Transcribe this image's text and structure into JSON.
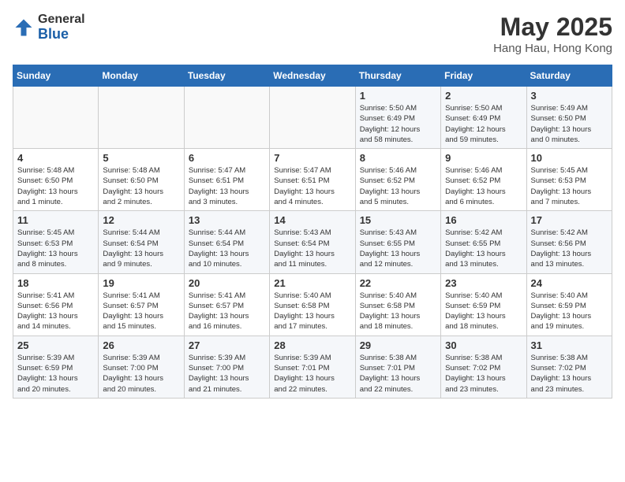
{
  "header": {
    "logo_general": "General",
    "logo_blue": "Blue",
    "month_year": "May 2025",
    "location": "Hang Hau, Hong Kong"
  },
  "days_of_week": [
    "Sunday",
    "Monday",
    "Tuesday",
    "Wednesday",
    "Thursday",
    "Friday",
    "Saturday"
  ],
  "weeks": [
    [
      {
        "day": "",
        "info": ""
      },
      {
        "day": "",
        "info": ""
      },
      {
        "day": "",
        "info": ""
      },
      {
        "day": "",
        "info": ""
      },
      {
        "day": "1",
        "info": "Sunrise: 5:50 AM\nSunset: 6:49 PM\nDaylight: 12 hours\nand 58 minutes."
      },
      {
        "day": "2",
        "info": "Sunrise: 5:50 AM\nSunset: 6:49 PM\nDaylight: 12 hours\nand 59 minutes."
      },
      {
        "day": "3",
        "info": "Sunrise: 5:49 AM\nSunset: 6:50 PM\nDaylight: 13 hours\nand 0 minutes."
      }
    ],
    [
      {
        "day": "4",
        "info": "Sunrise: 5:48 AM\nSunset: 6:50 PM\nDaylight: 13 hours\nand 1 minute."
      },
      {
        "day": "5",
        "info": "Sunrise: 5:48 AM\nSunset: 6:50 PM\nDaylight: 13 hours\nand 2 minutes."
      },
      {
        "day": "6",
        "info": "Sunrise: 5:47 AM\nSunset: 6:51 PM\nDaylight: 13 hours\nand 3 minutes."
      },
      {
        "day": "7",
        "info": "Sunrise: 5:47 AM\nSunset: 6:51 PM\nDaylight: 13 hours\nand 4 minutes."
      },
      {
        "day": "8",
        "info": "Sunrise: 5:46 AM\nSunset: 6:52 PM\nDaylight: 13 hours\nand 5 minutes."
      },
      {
        "day": "9",
        "info": "Sunrise: 5:46 AM\nSunset: 6:52 PM\nDaylight: 13 hours\nand 6 minutes."
      },
      {
        "day": "10",
        "info": "Sunrise: 5:45 AM\nSunset: 6:53 PM\nDaylight: 13 hours\nand 7 minutes."
      }
    ],
    [
      {
        "day": "11",
        "info": "Sunrise: 5:45 AM\nSunset: 6:53 PM\nDaylight: 13 hours\nand 8 minutes."
      },
      {
        "day": "12",
        "info": "Sunrise: 5:44 AM\nSunset: 6:54 PM\nDaylight: 13 hours\nand 9 minutes."
      },
      {
        "day": "13",
        "info": "Sunrise: 5:44 AM\nSunset: 6:54 PM\nDaylight: 13 hours\nand 10 minutes."
      },
      {
        "day": "14",
        "info": "Sunrise: 5:43 AM\nSunset: 6:54 PM\nDaylight: 13 hours\nand 11 minutes."
      },
      {
        "day": "15",
        "info": "Sunrise: 5:43 AM\nSunset: 6:55 PM\nDaylight: 13 hours\nand 12 minutes."
      },
      {
        "day": "16",
        "info": "Sunrise: 5:42 AM\nSunset: 6:55 PM\nDaylight: 13 hours\nand 13 minutes."
      },
      {
        "day": "17",
        "info": "Sunrise: 5:42 AM\nSunset: 6:56 PM\nDaylight: 13 hours\nand 13 minutes."
      }
    ],
    [
      {
        "day": "18",
        "info": "Sunrise: 5:41 AM\nSunset: 6:56 PM\nDaylight: 13 hours\nand 14 minutes."
      },
      {
        "day": "19",
        "info": "Sunrise: 5:41 AM\nSunset: 6:57 PM\nDaylight: 13 hours\nand 15 minutes."
      },
      {
        "day": "20",
        "info": "Sunrise: 5:41 AM\nSunset: 6:57 PM\nDaylight: 13 hours\nand 16 minutes."
      },
      {
        "day": "21",
        "info": "Sunrise: 5:40 AM\nSunset: 6:58 PM\nDaylight: 13 hours\nand 17 minutes."
      },
      {
        "day": "22",
        "info": "Sunrise: 5:40 AM\nSunset: 6:58 PM\nDaylight: 13 hours\nand 18 minutes."
      },
      {
        "day": "23",
        "info": "Sunrise: 5:40 AM\nSunset: 6:59 PM\nDaylight: 13 hours\nand 18 minutes."
      },
      {
        "day": "24",
        "info": "Sunrise: 5:40 AM\nSunset: 6:59 PM\nDaylight: 13 hours\nand 19 minutes."
      }
    ],
    [
      {
        "day": "25",
        "info": "Sunrise: 5:39 AM\nSunset: 6:59 PM\nDaylight: 13 hours\nand 20 minutes."
      },
      {
        "day": "26",
        "info": "Sunrise: 5:39 AM\nSunset: 7:00 PM\nDaylight: 13 hours\nand 20 minutes."
      },
      {
        "day": "27",
        "info": "Sunrise: 5:39 AM\nSunset: 7:00 PM\nDaylight: 13 hours\nand 21 minutes."
      },
      {
        "day": "28",
        "info": "Sunrise: 5:39 AM\nSunset: 7:01 PM\nDaylight: 13 hours\nand 22 minutes."
      },
      {
        "day": "29",
        "info": "Sunrise: 5:38 AM\nSunset: 7:01 PM\nDaylight: 13 hours\nand 22 minutes."
      },
      {
        "day": "30",
        "info": "Sunrise: 5:38 AM\nSunset: 7:02 PM\nDaylight: 13 hours\nand 23 minutes."
      },
      {
        "day": "31",
        "info": "Sunrise: 5:38 AM\nSunset: 7:02 PM\nDaylight: 13 hours\nand 23 minutes."
      }
    ]
  ]
}
